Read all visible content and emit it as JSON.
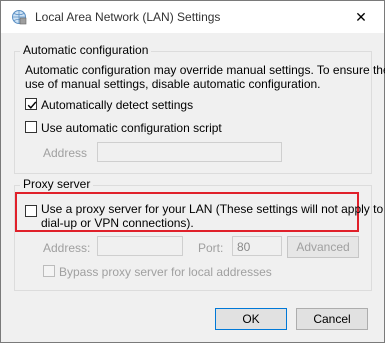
{
  "window": {
    "title": "Local Area Network (LAN) Settings",
    "close_glyph": "✕"
  },
  "automatic": {
    "legend": "Automatic configuration",
    "description_line1": "Automatic configuration may override manual settings.  To ensure the",
    "description_line2": "use of manual settings, disable automatic configuration.",
    "detect_label": "Automatically detect settings",
    "detect_checked": true,
    "script_label": "Use automatic configuration script",
    "script_checked": false,
    "address_label": "Address",
    "address_value": ""
  },
  "proxy": {
    "legend": "Proxy server",
    "use_proxy_line1": "Use a proxy server for your LAN (These settings will not apply to",
    "use_proxy_line2": "dial-up or VPN connections).",
    "use_proxy_checked": false,
    "address_label": "Address:",
    "address_value": "",
    "port_label": "Port:",
    "port_value": "80",
    "advanced_label": "Advanced",
    "bypass_label": "Bypass proxy server for local addresses",
    "bypass_checked": false
  },
  "buttons": {
    "ok_label": "OK",
    "cancel_label": "Cancel"
  },
  "colors": {
    "highlight": "#e0202a",
    "default_button_border": "#0078d7"
  },
  "icons": {
    "app": "network-settings-icon",
    "close": "close-icon",
    "check": "checkmark-icon"
  }
}
